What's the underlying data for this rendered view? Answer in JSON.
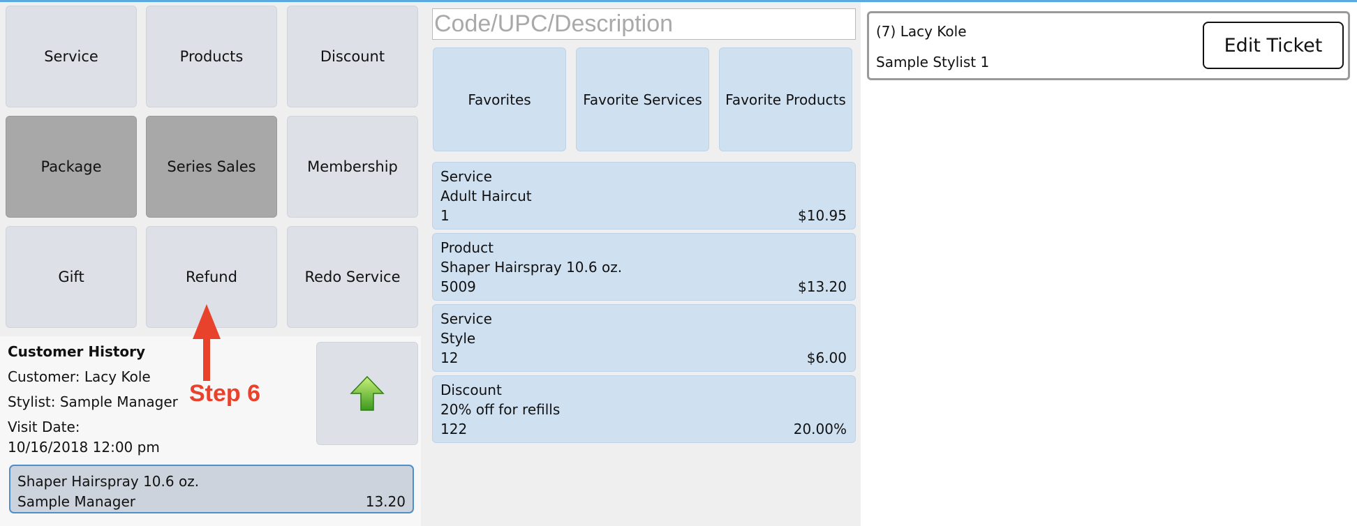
{
  "categories": [
    {
      "label": "Service"
    },
    {
      "label": "Products"
    },
    {
      "label": "Discount"
    },
    {
      "label": "Package"
    },
    {
      "label": "Series Sales"
    },
    {
      "label": "Membership"
    },
    {
      "label": "Gift"
    },
    {
      "label": "Refund"
    },
    {
      "label": "Redo Service"
    }
  ],
  "history": {
    "title": "Customer History",
    "customer": "Customer: Lacy Kole",
    "stylist": "Stylist: Sample Manager",
    "visit_date_label": "Visit Date:",
    "visit_date": "10/16/2018 12:00 pm",
    "items": [
      {
        "name": "Shaper Hairspray 10.6 oz.",
        "stylist": "Sample Manager",
        "price": "13.20"
      }
    ]
  },
  "annotation": {
    "step": "Step 6",
    "color": "#e8412c"
  },
  "search": {
    "placeholder": "Code/UPC/Description"
  },
  "favorites": [
    {
      "label": "Favorites"
    },
    {
      "label": "Favorite Services"
    },
    {
      "label": "Favorite Products"
    }
  ],
  "ticket_items": [
    {
      "type": "Service",
      "name": "Adult Haircut",
      "code": "1",
      "price": "$10.95"
    },
    {
      "type": "Product",
      "name": "Shaper Hairspray 10.6 oz.",
      "code": "5009",
      "price": "$13.20"
    },
    {
      "type": "Service",
      "name": "Style",
      "code": "12",
      "price": "$6.00"
    },
    {
      "type": "Discount",
      "name": "20% off for refills",
      "code": "122",
      "price": "20.00%"
    }
  ],
  "ticket": {
    "customer": "(7) Lacy Kole",
    "stylist": "Sample Stylist 1",
    "edit_label": "Edit Ticket"
  },
  "colors": {
    "button": "#dde1e7",
    "button_dark": "#a8a8a8",
    "tile_blue": "#cfe0f1",
    "accent_blue": "#5aa9e0"
  }
}
